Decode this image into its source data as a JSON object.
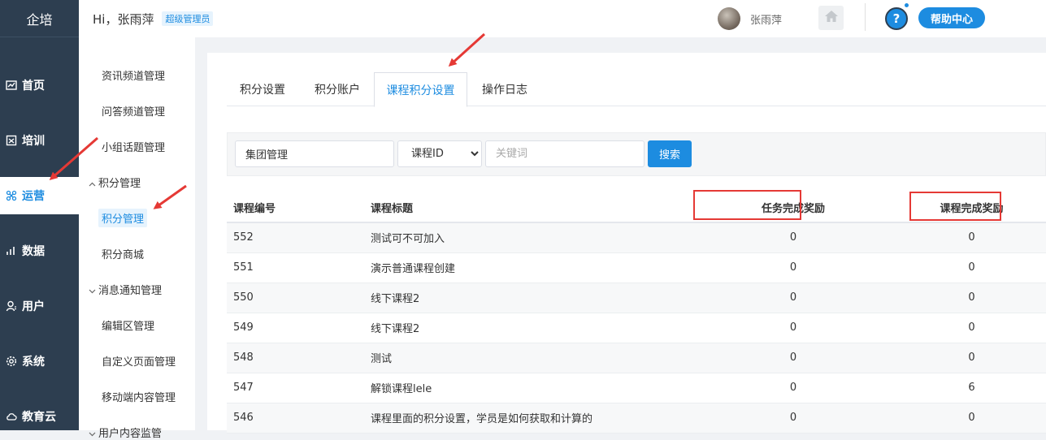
{
  "app": {
    "logo": "企培"
  },
  "header": {
    "greeting": "Hi，张雨萍",
    "role_badge": "超级管理员",
    "username": "张雨萍",
    "help_label": "帮助中心",
    "help_icon": "?"
  },
  "sidebar": {
    "items": [
      {
        "label": "首页",
        "icon": "dashboard-icon"
      },
      {
        "label": "培训",
        "icon": "book-icon"
      },
      {
        "label": "运营",
        "icon": "operations-icon",
        "active": true
      },
      {
        "label": "数据",
        "icon": "chart-icon"
      },
      {
        "label": "用户",
        "icon": "user-icon"
      },
      {
        "label": "系统",
        "icon": "gear-icon"
      },
      {
        "label": "教育云",
        "icon": "cloud-icon"
      }
    ]
  },
  "submenu": {
    "items": [
      {
        "label": "资讯频道管理"
      },
      {
        "label": "问答频道管理"
      },
      {
        "label": "小组话题管理"
      },
      {
        "label": "积分管理",
        "group": true
      },
      {
        "label": "积分管理",
        "active": true
      },
      {
        "label": "积分商城"
      },
      {
        "label": "消息通知管理",
        "group": true
      },
      {
        "label": "编辑区管理"
      },
      {
        "label": "自定义页面管理"
      },
      {
        "label": "移动端内容管理"
      },
      {
        "label": "用户内容监管",
        "group": true
      }
    ]
  },
  "tabs": [
    {
      "label": "积分设置"
    },
    {
      "label": "积分账户"
    },
    {
      "label": "课程积分设置",
      "active": true
    },
    {
      "label": "操作日志"
    }
  ],
  "filter": {
    "org_value": "集团管理",
    "field_select": "课程ID",
    "keyword_placeholder": "关键词",
    "search_label": "搜索"
  },
  "table": {
    "headers": [
      "课程编号",
      "课程标题",
      "任务完成奖励",
      "课程完成奖励"
    ],
    "rows": [
      [
        "552",
        "测试可不可加入",
        "0",
        "0"
      ],
      [
        "551",
        "演示普通课程创建",
        "0",
        "0"
      ],
      [
        "550",
        "线下课程2",
        "0",
        "0"
      ],
      [
        "549",
        "线下课程2",
        "0",
        "0"
      ],
      [
        "548",
        "测试",
        "0",
        "0"
      ],
      [
        "547",
        "解锁课程lele",
        "0",
        "6"
      ],
      [
        "546",
        "课程里面的积分设置，学员是如何获取和计算的",
        "0",
        "0"
      ]
    ]
  },
  "colors": {
    "accent": "#1d8ce0",
    "sidebar_bg": "#2d3e50",
    "highlight_red": "#e53935"
  }
}
